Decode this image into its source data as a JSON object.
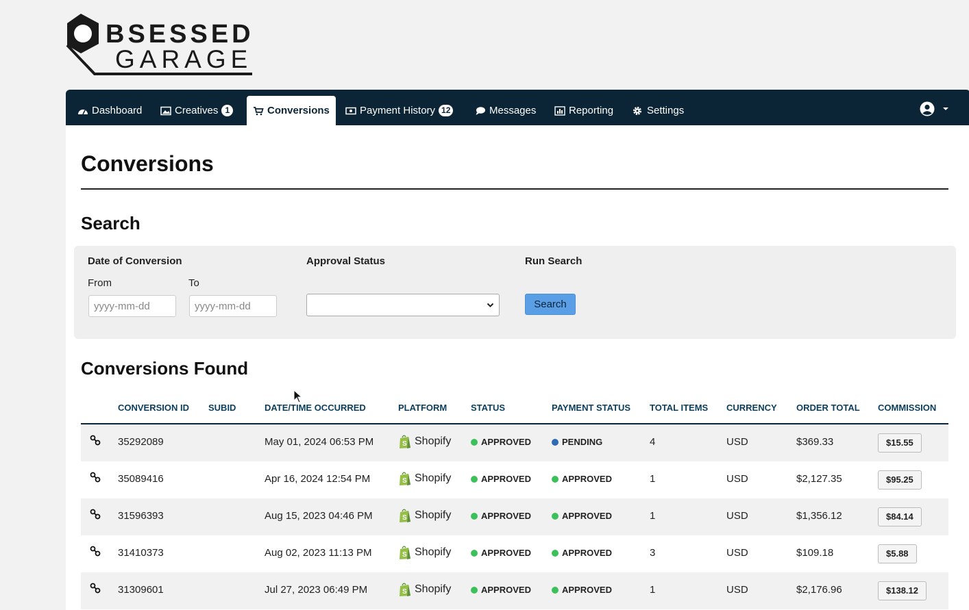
{
  "logo": {
    "line1": "BSESSED",
    "line2": "GARAGE"
  },
  "nav": {
    "items": [
      {
        "label": "Dashboard",
        "icon": "dashboard-icon"
      },
      {
        "label": "Creatives",
        "icon": "image-icon",
        "badge": "1"
      },
      {
        "label": "Conversions",
        "icon": "cart-icon",
        "active": true
      },
      {
        "label": "Payment History",
        "icon": "money-icon",
        "badge": "12"
      },
      {
        "label": "Messages",
        "icon": "chat-icon"
      },
      {
        "label": "Reporting",
        "icon": "chart-icon"
      },
      {
        "label": "Settings",
        "icon": "gear-icon"
      }
    ],
    "user_icon": "user-circle-icon"
  },
  "page": {
    "title": "Conversions"
  },
  "search": {
    "heading": "Search",
    "date_label": "Date of Conversion",
    "from_label": "From",
    "to_label": "To",
    "from_placeholder": "yyyy-mm-dd",
    "to_placeholder": "yyyy-mm-dd",
    "approval_label": "Approval Status",
    "approval_value": "",
    "run_label": "Run Search",
    "button_label": "Search"
  },
  "results": {
    "heading": "Conversions Found",
    "columns": [
      "CONVERSION ID",
      "SUBID",
      "DATE/TIME OCCURRED",
      "PLATFORM",
      "STATUS",
      "PAYMENT STATUS",
      "TOTAL ITEMS",
      "CURRENCY",
      "ORDER TOTAL",
      "COMMISSION"
    ],
    "rows": [
      {
        "id": "35292089",
        "subid": "",
        "datetime": "May 01, 2024 06:53 PM",
        "platform": "Shopify",
        "status": "APPROVED",
        "payment_status": "PENDING",
        "items": "4",
        "currency": "USD",
        "total": "$369.33",
        "commission": "$15.55"
      },
      {
        "id": "35089416",
        "subid": "",
        "datetime": "Apr 16, 2024 12:54 PM",
        "platform": "Shopify",
        "status": "APPROVED",
        "payment_status": "APPROVED",
        "items": "1",
        "currency": "USD",
        "total": "$2,127.35",
        "commission": "$95.25"
      },
      {
        "id": "31596393",
        "subid": "",
        "datetime": "Aug 15, 2023 04:46 PM",
        "platform": "Shopify",
        "status": "APPROVED",
        "payment_status": "APPROVED",
        "items": "1",
        "currency": "USD",
        "total": "$1,356.12",
        "commission": "$84.14"
      },
      {
        "id": "31410373",
        "subid": "",
        "datetime": "Aug 02, 2023 11:13 PM",
        "platform": "Shopify",
        "status": "APPROVED",
        "payment_status": "APPROVED",
        "items": "3",
        "currency": "USD",
        "total": "$109.18",
        "commission": "$5.88"
      },
      {
        "id": "31309601",
        "subid": "",
        "datetime": "Jul 27, 2023 06:49 PM",
        "platform": "Shopify",
        "status": "APPROVED",
        "payment_status": "APPROVED",
        "items": "1",
        "currency": "USD",
        "total": "$2,176.96",
        "commission": "$138.12"
      }
    ]
  },
  "colors": {
    "nav_bg": "#0b2436",
    "approved": "#3cc15a",
    "pending": "#2f6bb5",
    "button": "#5a9fe6"
  }
}
